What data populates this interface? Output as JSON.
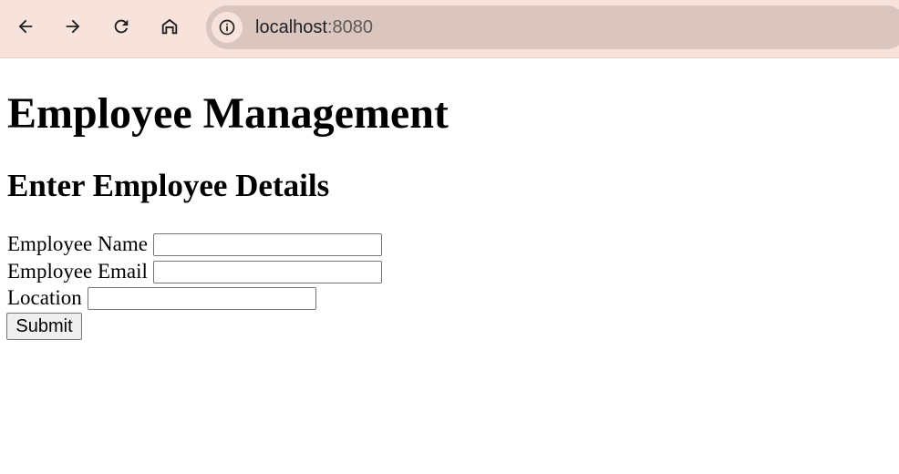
{
  "browser": {
    "url_host": "localhost",
    "url_port": ":8080",
    "icons": {
      "back": "back-arrow-icon",
      "forward": "forward-arrow-icon",
      "reload": "reload-icon",
      "home": "home-icon",
      "site_info": "info-icon"
    },
    "colors": {
      "toolbar_bg": "#f7e2dc",
      "address_bar_bg": "#dac5bf"
    }
  },
  "page": {
    "title": "Employee Management",
    "subtitle": "Enter Employee Details",
    "form": {
      "fields": [
        {
          "label": "Employee Name",
          "value": ""
        },
        {
          "label": "Employee Email",
          "value": ""
        },
        {
          "label": "Location",
          "value": ""
        }
      ],
      "submit_label": "Submit"
    }
  }
}
